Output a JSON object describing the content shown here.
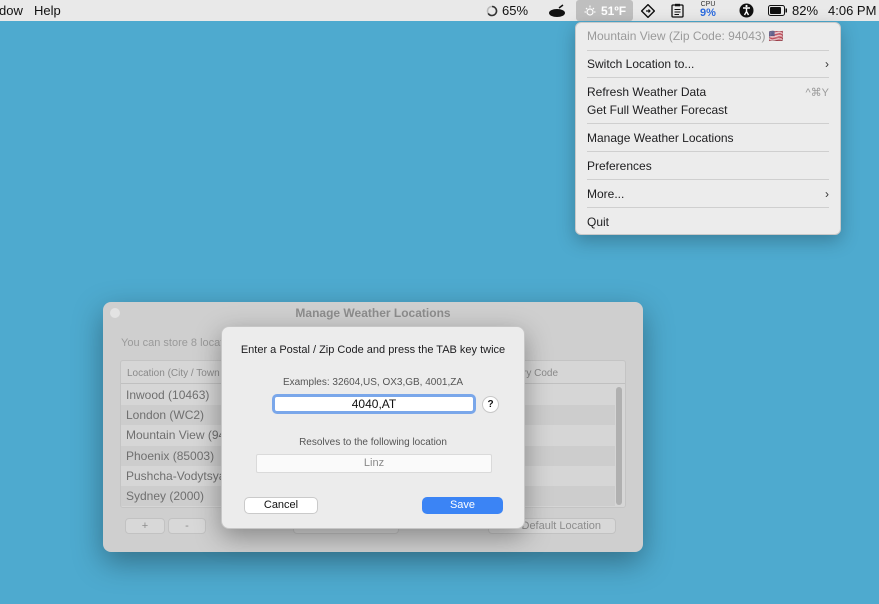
{
  "menubar": {
    "items": [
      "dow",
      "Help"
    ],
    "battery_ring": "65%",
    "weather": {
      "temp": "51ºF",
      "icon": "sun-icon"
    },
    "cpu": {
      "label": "CPU",
      "value": "9%"
    },
    "battery": "82%",
    "clock": "4:06 PM"
  },
  "dropdown": {
    "current_location": "Mountain View (Zip Code: 94043) 🇺🇸",
    "switch_location": "Switch Location to...",
    "refresh": "Refresh Weather Data",
    "refresh_shortcut": "^⌘Y",
    "full_forecast": "Get Full Weather Forecast",
    "manage_locations": "Manage Weather Locations",
    "preferences": "Preferences",
    "more": "More...",
    "quit": "Quit"
  },
  "window": {
    "title": "Manage Weather Locations",
    "description": "You can store 8 locat",
    "columns": [
      "Location (City / Town",
      "ry Code"
    ],
    "rows": [
      "Inwood (10463)",
      "London (WC2)",
      "Mountain View (94",
      "Phoenix (85003)",
      "Pushcha-Vodytsya",
      "Sydney (2000)"
    ],
    "add_label": "+",
    "remove_label": "-",
    "default_label": "Default Location"
  },
  "sheet": {
    "title": "Enter a Postal / Zip Code and press the TAB key twice",
    "examples": "Examples: 32604,US, OX3,GB, 4001,ZA",
    "zip_value": "4040,AT",
    "help_label": "?",
    "resolves_label": "Resolves to the following location",
    "resolved_location": "Linz",
    "cancel_label": "Cancel",
    "save_label": "Save"
  },
  "colors": {
    "desktop": "#4eaacf",
    "accent": "#3b84f5"
  }
}
